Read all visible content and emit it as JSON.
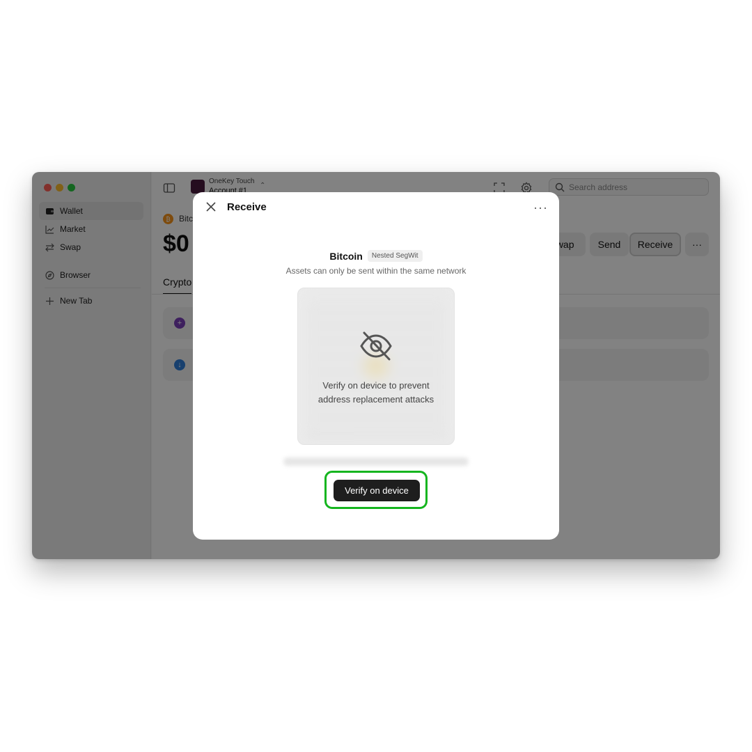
{
  "sidebar": {
    "items": [
      {
        "label": "Wallet",
        "icon": "wallet-icon"
      },
      {
        "label": "Market",
        "icon": "chart-icon"
      },
      {
        "label": "Swap",
        "icon": "swap-icon"
      },
      {
        "label": "Browser",
        "icon": "compass-icon"
      },
      {
        "label": "New Tab",
        "icon": "plus-icon"
      }
    ]
  },
  "topbar": {
    "device_name": "OneKey Touch",
    "account_name": "Account #1",
    "search_placeholder": "Search address"
  },
  "asset": {
    "coin_name": "Bitcoin",
    "balance": "$0",
    "tab_label": "Crypto"
  },
  "actions": {
    "swap_label": "Swap",
    "send_label": "Send",
    "receive_label": "Receive",
    "more_label": "···"
  },
  "modal": {
    "title": "Receive",
    "more_label": "···",
    "network_name": "Bitcoin",
    "network_badge": "Nested SegWit",
    "network_note": "Assets can only be sent within the same network",
    "qr_message_line1": "Verify on device to prevent",
    "qr_message_line2": "address replacement attacks",
    "verify_button_label": "Verify on device"
  },
  "colors": {
    "highlight": "#15b51f",
    "bitcoin": "#f7931a"
  }
}
